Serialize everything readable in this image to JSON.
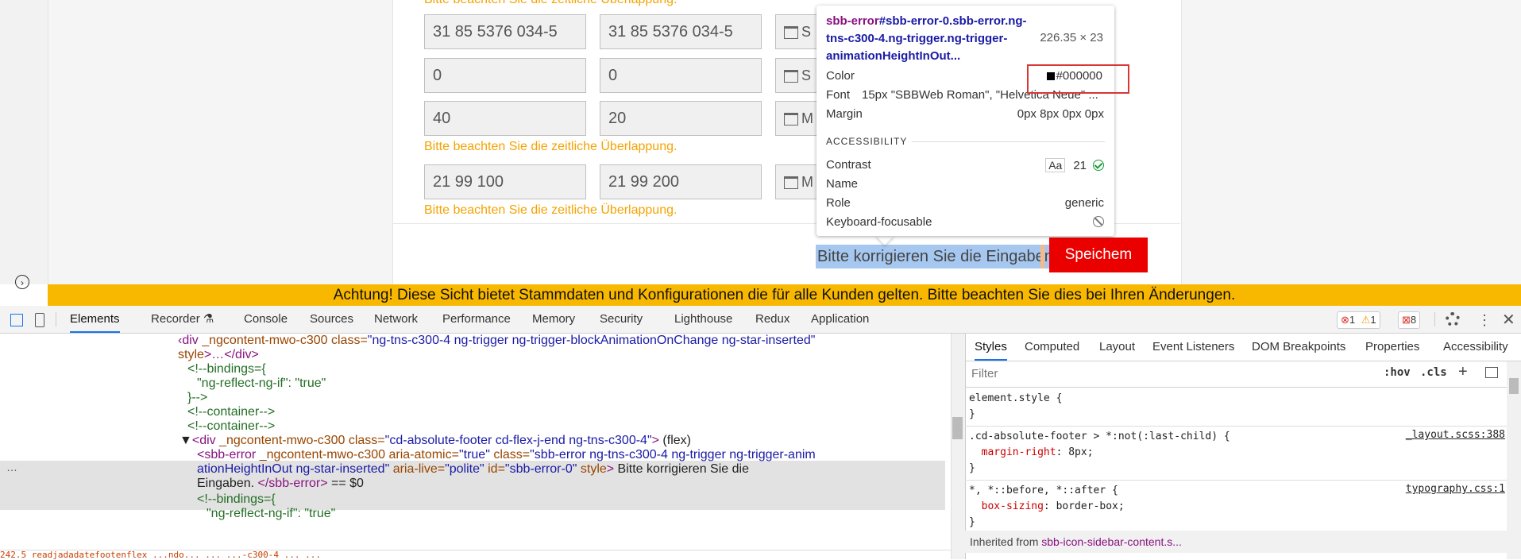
{
  "form": {
    "warn_top": "Bitte beachten Sie die zeitliche Überlappung.",
    "rows": [
      {
        "from": "31 85 5376 034-5",
        "to": "31 85 5376 034-5",
        "date_text": "S"
      },
      {
        "from": "0",
        "to": "0",
        "date_text": "S"
      },
      {
        "from": "40",
        "to": "20",
        "date_text": "M"
      },
      {
        "from": "21 99 100",
        "to": "21 99 200",
        "date_text": "M"
      }
    ],
    "warning": "Bitte beachten Sie die zeitliche Überlappung.",
    "error_message": "Bitte korrigieren Sie die Eingaben.",
    "save_label": "Speichem"
  },
  "tooltip": {
    "selector_tag": "sbb-error",
    "selector_rest": "#sbb-error-0.sbb-error.ng-tns-c300-4.ng-trigger.ng-trigger-animationHeightInOut...",
    "size": "226.35 × 23",
    "color_label": "Color",
    "color_value": "#000000",
    "font_label": "Font",
    "font_value": "15px \"SBBWeb Roman\", \"Helvetica Neue\" ...",
    "margin_label": "Margin",
    "margin_value": "0px 8px 0px 0px",
    "accessibility_label": "ACCESSIBILITY",
    "contrast_label": "Contrast",
    "contrast_aa": "Aa",
    "contrast_value": "21",
    "name_label": "Name",
    "role_label": "Role",
    "role_value": "generic",
    "keyboard_label": "Keyboard-focusable"
  },
  "banner": "Achtung! Diese Sicht bietet Stammdaten und Konfigurationen die für alle Kunden gelten. Bitte beachten Sie dies bei Ihren Änderungen.",
  "devtools": {
    "tabs": [
      "Elements",
      "Recorder ⚗",
      "Console",
      "Sources",
      "Network",
      "Performance",
      "Memory",
      "Security",
      "Lighthouse",
      "Redux",
      "Application"
    ],
    "badges": {
      "errors": "1",
      "warnings": "1",
      "issues": "8"
    },
    "elements_lines": [
      {
        "indent": 224,
        "parts": [
          [
            "tag",
            "‹div "
          ],
          [
            "attr",
            "_ngcontent-mwo-c300 class="
          ],
          [
            "val",
            "\"ng-tns-c300-4 ng-trigger ng-trigger-blockAnimationOnChange ng-star-inserted\""
          ]
        ]
      },
      {
        "indent": 224,
        "parts": [
          [
            "attr",
            "style"
          ],
          [
            "tag",
            ">…</div>"
          ]
        ]
      },
      {
        "indent": 236,
        "parts": [
          [
            "cmt",
            "<!--bindings={"
          ]
        ]
      },
      {
        "indent": 248,
        "parts": [
          [
            "cmt",
            "\"ng-reflect-ng-if\": \"true\""
          ]
        ]
      },
      {
        "indent": 236,
        "parts": [
          [
            "cmt",
            "}-->"
          ]
        ]
      },
      {
        "indent": 236,
        "parts": [
          [
            "cmt",
            "<!--container-->"
          ]
        ]
      },
      {
        "indent": 236,
        "parts": [
          [
            "cmt",
            "<!--container-->"
          ]
        ]
      },
      {
        "indent": 226,
        "parts": [
          [
            "plain",
            "▼"
          ],
          [
            "tag",
            "<div "
          ],
          [
            "attr",
            "_ngcontent-mwo-c300 class="
          ],
          [
            "val",
            "\"cd-absolute-footer cd-flex-j-end ng-tns-c300-4\""
          ],
          [
            "tag",
            ">"
          ],
          [
            "plain",
            " (flex)"
          ]
        ]
      },
      {
        "indent": 248,
        "parts": [
          [
            "tag",
            "<sbb-error "
          ],
          [
            "attr",
            "_ngcontent-mwo-c300 aria-atomic="
          ],
          [
            "val",
            "\"true\""
          ],
          [
            "attr",
            " class="
          ],
          [
            "val",
            "\"sbb-error ng-tns-c300-4 ng-trigger ng-trigger-anim"
          ]
        ]
      },
      {
        "indent": 248,
        "parts": [
          [
            "val",
            "ationHeightInOut ng-star-inserted\""
          ],
          [
            "attr",
            " aria-live="
          ],
          [
            "val",
            "\"polite\""
          ],
          [
            "attr",
            " id="
          ],
          [
            "val",
            "\"sbb-error-0\""
          ],
          [
            "attr",
            " style"
          ],
          [
            "tag",
            ">"
          ],
          [
            "plain",
            " Bitte korrigieren Sie die"
          ]
        ]
      },
      {
        "indent": 248,
        "parts": [
          [
            "plain",
            "Eingaben. "
          ],
          [
            "tag",
            "</sbb-error>"
          ],
          [
            "plain",
            " == $0"
          ]
        ]
      },
      {
        "indent": 248,
        "parts": [
          [
            "cmt",
            "<!--bindings={"
          ]
        ]
      },
      {
        "indent": 260,
        "parts": [
          [
            "cmt",
            "\"ng-reflect-ng-if\": \"true\""
          ]
        ]
      }
    ],
    "ellipsis": "…",
    "bottom_strip": "242.5 readjadadatefootenflex ...ndo... ... ...-c300-4 ... ..."
  },
  "styles": {
    "tabs": [
      "Styles",
      "Computed",
      "Layout",
      "Event Listeners",
      "DOM Breakpoints",
      "Properties",
      "Accessibility"
    ],
    "filter_placeholder": "Filter",
    "hov": ":hov",
    "cls": ".cls",
    "rules": [
      {
        "selector": "element.style {",
        "props": [],
        "close": "}",
        "source": ""
      },
      {
        "selector": ".cd-absolute-footer > *:not(:last-child) {",
        "props": [
          [
            "margin-right",
            "8px;"
          ]
        ],
        "close": "}",
        "source": "_layout.scss:388"
      },
      {
        "selector": "*, *::before, *::after {",
        "props": [
          [
            "box-sizing",
            "border-box;"
          ]
        ],
        "close": "}",
        "source": "typography.css:1"
      }
    ],
    "inherited_prefix": "Inherited from ",
    "inherited_link": "sbb-icon-sidebar-content.s..."
  }
}
